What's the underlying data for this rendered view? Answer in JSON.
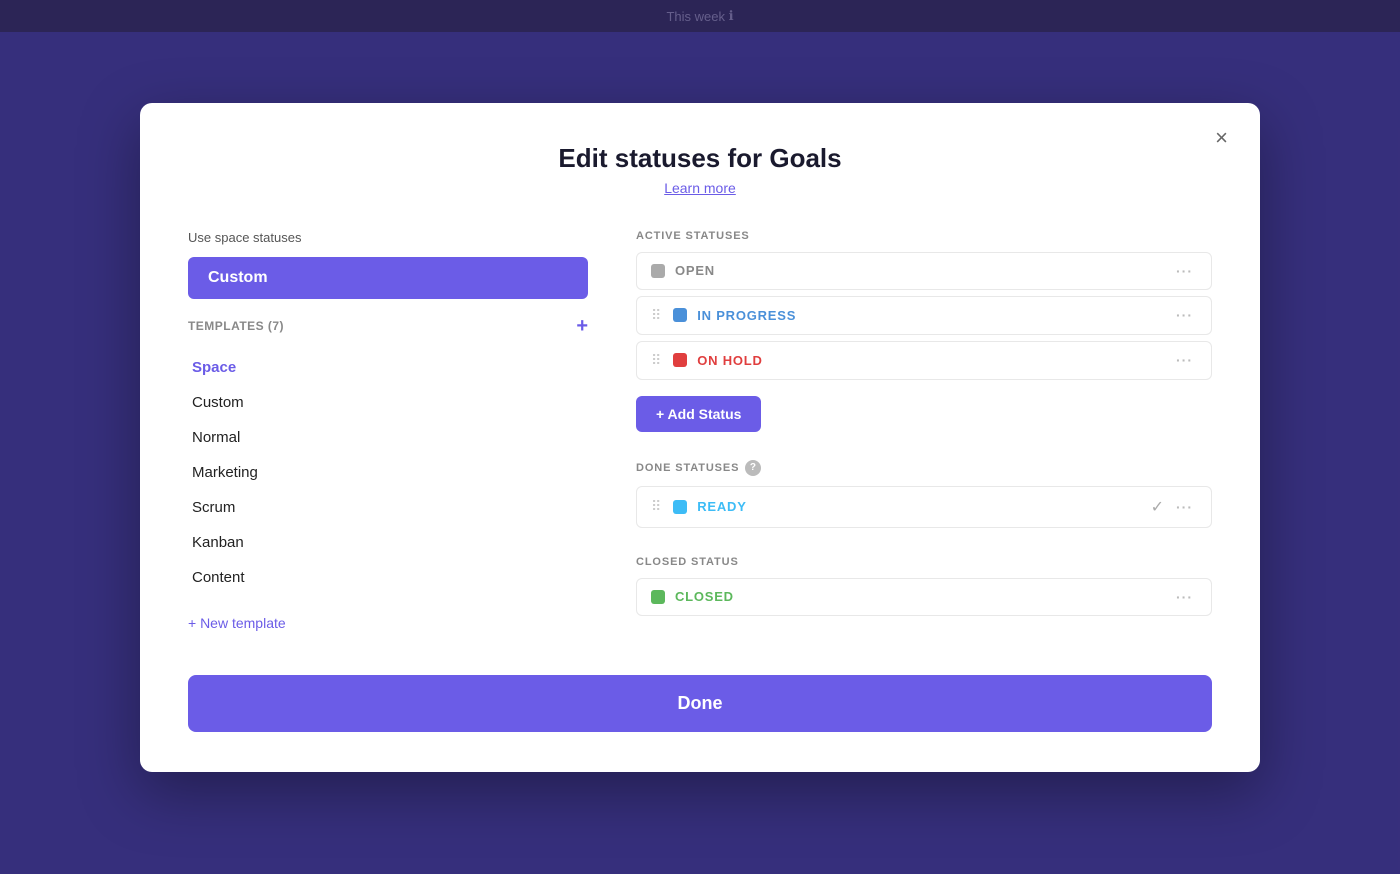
{
  "app": {
    "top_bar_text": "This week",
    "top_bar_icon": "ℹ"
  },
  "modal": {
    "title": "Edit statuses for Goals",
    "learn_more": "Learn more",
    "close_label": "×",
    "left_panel": {
      "use_space_label": "Use space statuses",
      "selected_template": "Custom",
      "templates_section_label": "TEMPLATES (7)",
      "templates_add_label": "+",
      "templates": [
        {
          "id": "space",
          "label": "Space",
          "active": true
        },
        {
          "id": "custom",
          "label": "Custom",
          "active": false
        },
        {
          "id": "normal",
          "label": "Normal",
          "active": false
        },
        {
          "id": "marketing",
          "label": "Marketing",
          "active": false
        },
        {
          "id": "scrum",
          "label": "Scrum",
          "active": false
        },
        {
          "id": "kanban",
          "label": "Kanban",
          "active": false
        },
        {
          "id": "content",
          "label": "Content",
          "active": false
        }
      ],
      "new_template_label": "+ New template"
    },
    "right_panel": {
      "active_statuses_label": "ACTIVE STATUSES",
      "active_statuses": [
        {
          "id": "open",
          "name": "OPEN",
          "color": "gray",
          "text_color": "gray-text"
        },
        {
          "id": "in-progress",
          "name": "IN PROGRESS",
          "color": "blue",
          "text_color": "blue-text",
          "draggable": true
        },
        {
          "id": "on-hold",
          "name": "ON HOLD",
          "color": "red",
          "text_color": "red-text",
          "draggable": true
        }
      ],
      "add_status_label": "+ Add Status",
      "done_statuses_label": "DONE STATUSES",
      "done_statuses": [
        {
          "id": "ready",
          "name": "READY",
          "color": "blue-done",
          "text_color": "cyan-text",
          "has_check": true,
          "draggable": true
        }
      ],
      "closed_status_label": "CLOSED STATUS",
      "closed_statuses": [
        {
          "id": "closed",
          "name": "CLOSED",
          "color": "green",
          "text_color": "green-text"
        }
      ]
    },
    "done_button_label": "Done"
  }
}
